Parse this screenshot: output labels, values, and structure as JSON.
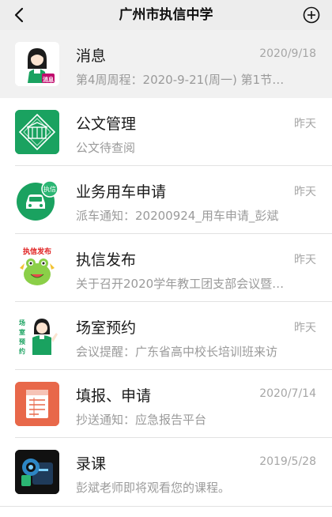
{
  "header": {
    "back_icon": "chevron-left-icon",
    "title": "广州市执信中学",
    "add_icon": "plus-circle-icon"
  },
  "items": [
    {
      "name": "消息",
      "date": "2020/9/18",
      "preview": "第4周周程：2020-9-21(周一) 第1节…",
      "icon": "girl-avatar-icon",
      "icon_text": "消息"
    },
    {
      "name": "公文管理",
      "date": "昨天",
      "preview": "公文待查阅",
      "icon": "school-gate-icon"
    },
    {
      "name": "业务用车申请",
      "date": "昨天",
      "preview": "派车通知：20200924_用车申请_彭斌",
      "icon": "car-icon",
      "icon_text": "执信"
    },
    {
      "name": "执信发布",
      "date": "昨天",
      "preview": "关于召开2020学年教工团支部会议暨…",
      "icon": "frog-mascot-icon",
      "icon_text": "执信发布"
    },
    {
      "name": "场室预约",
      "date": "昨天",
      "preview": "会议提醒：广东省高中校长培训班来访",
      "icon": "student-mascot-icon",
      "icon_text": "场室预约"
    },
    {
      "name": "填报、申请",
      "date": "2020/7/14",
      "preview": "抄送通知：应急报告平台",
      "icon": "form-icon"
    },
    {
      "name": "录课",
      "date": "2019/5/28",
      "preview": "彭斌老师即将观看您的课程。",
      "icon": "video-camera-icon"
    }
  ],
  "colors": {
    "header_bg": "#ededed",
    "green": "#1aa260",
    "green_dark": "#168a53",
    "orange": "#e8684a",
    "black": "#111111",
    "highlight": "#f1f1f1"
  }
}
